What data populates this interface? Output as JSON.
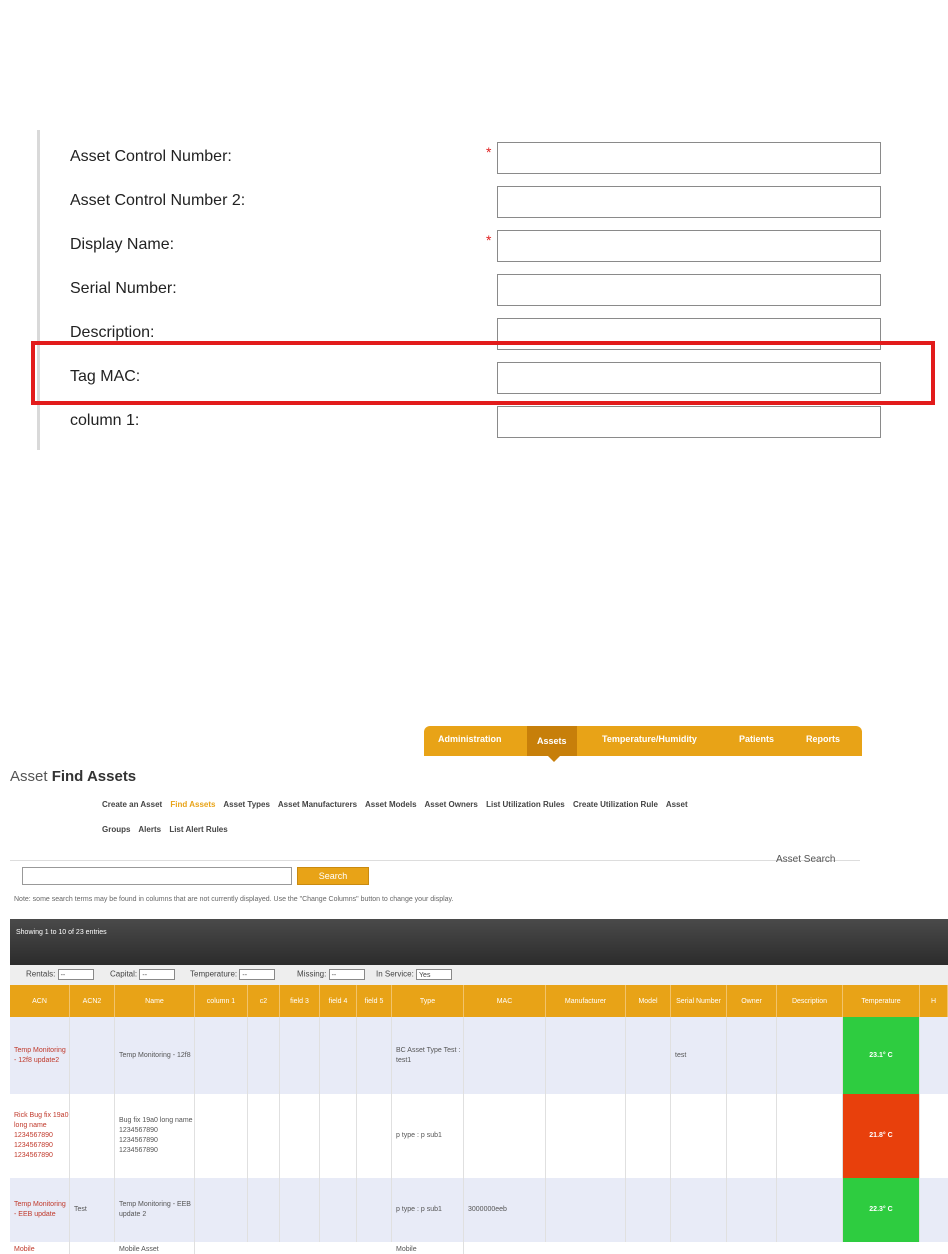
{
  "form": {
    "fields": [
      {
        "label": "Asset Control Number:",
        "required": true,
        "value": ""
      },
      {
        "label": "Asset Control Number 2:",
        "required": false,
        "value": ""
      },
      {
        "label": "Display Name:",
        "required": true,
        "value": ""
      },
      {
        "label": "Serial Number:",
        "required": false,
        "value": ""
      },
      {
        "label": "Description:",
        "required": false,
        "value": ""
      },
      {
        "label": "Tag MAC:",
        "required": false,
        "value": ""
      },
      {
        "label": "column 1:",
        "required": false,
        "value": ""
      }
    ],
    "required_marker": "*"
  },
  "nav": {
    "tabs": [
      "Administration",
      "Assets",
      "Temperature/Humidity",
      "Patients",
      "Reports"
    ],
    "active": "Assets"
  },
  "page_title": {
    "prefix": "Asset",
    "bold": "Find Assets"
  },
  "submenu": {
    "line1": [
      "Create an Asset",
      "Find Assets",
      "Asset Types",
      "Asset Manufacturers",
      "Asset Models",
      "Asset Owners",
      "List Utilization Rules",
      "Create Utilization Rule",
      "Asset"
    ],
    "line2": [
      "Groups",
      "Alerts",
      "List Alert Rules"
    ],
    "active": "Find Assets"
  },
  "search": {
    "legend": "Asset Search",
    "button": "Search",
    "value": "",
    "note": "Note: some search terms may be found in columns that are not currently displayed. Use the \"Change Columns\" button to change your display."
  },
  "table_info": "Showing 1 to 10 of 23 entries",
  "filters": [
    {
      "label": "Rentals:",
      "value": "--"
    },
    {
      "label": "Capital:",
      "value": "--"
    },
    {
      "label": "Temperature:",
      "value": "--"
    },
    {
      "label": "Missing:",
      "value": "--"
    },
    {
      "label": "In Service:",
      "value": "Yes"
    }
  ],
  "columns": [
    "ACN",
    "ACN2",
    "Name",
    "column 1",
    "c2",
    "field 3",
    "field 4",
    "field 5",
    "Type",
    "MAC",
    "Manufacturer",
    "Model",
    "Serial Number",
    "Owner",
    "Description",
    "Temperature",
    "H"
  ],
  "rows": [
    {
      "acn": "Temp Monitoring - 12f8 update2",
      "acn2": "",
      "name": "Temp Monitoring - 12f8",
      "type": "BC Asset Type Test : test1",
      "mac": "",
      "serial": "test",
      "temperature": "23.1° C",
      "temp_color": "#2ecc40"
    },
    {
      "acn": "Rick Bug fix 19a0 long name 1234567890 1234567890 1234567890",
      "acn2": "",
      "name": "Bug fix 19a0 long name 1234567890 1234567890 1234567890",
      "type": "p type : p sub1",
      "mac": "",
      "serial": "",
      "temperature": "21.8° C",
      "temp_color": "#e8400c"
    },
    {
      "acn": "Temp Monitoring - EEB update",
      "acn2": "Test",
      "name": "Temp Monitoring - EEB update 2",
      "type": "p type : p sub1",
      "mac": "3000000eeb",
      "serial": "",
      "temperature": "22.3° C",
      "temp_color": "#2ecc40"
    },
    {
      "acn": "Mobile",
      "acn2": "",
      "name": "Mobile Asset",
      "type": "Mobile",
      "mac": "",
      "serial": "",
      "temperature": "",
      "temp_color": "#ffffff"
    }
  ]
}
